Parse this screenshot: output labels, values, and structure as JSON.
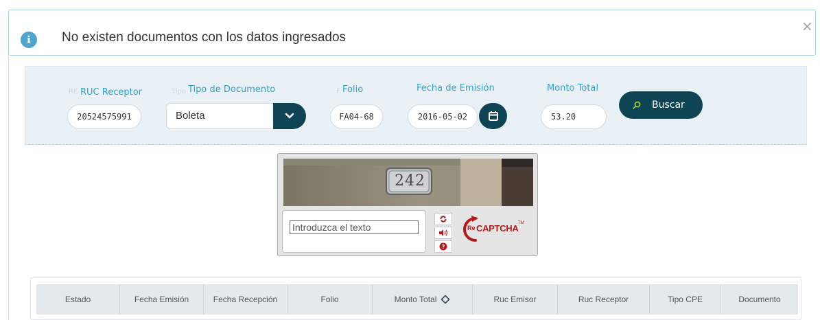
{
  "alert": {
    "message": "No existen documentos con los datos ingresados",
    "info_icon": "info-icon",
    "close_icon": "close-icon"
  },
  "search": {
    "ruc_receptor": {
      "label": "RUC Receptor",
      "ghost": "RE",
      "value": "20524575991"
    },
    "tipo_documento": {
      "label": "Tipo de Documento",
      "ghost": "Tipo",
      "value": "Boleta"
    },
    "folio": {
      "label": "Folio",
      "ghost": "F",
      "value": "FA04-68"
    },
    "fecha_emision": {
      "label": "Fecha de Emisión",
      "value": "2016-05-02"
    },
    "monto_total": {
      "label": "Monto Total",
      "value": "53.20"
    },
    "buscar_label": "Buscar"
  },
  "captcha": {
    "image_text": "242",
    "input_placeholder": "Introduzca el texto",
    "logo_text": "CAPTCHA",
    "logo_prefix": "Re",
    "tm": "TM"
  },
  "table": {
    "headers": [
      "Estado",
      "Fecha Emisión",
      "Fecha Recepción",
      "Folio",
      "Monto Total",
      "Ruc Emisor",
      "Ruc Receptor",
      "Tipo CPE",
      "Documento"
    ]
  },
  "colors": {
    "accent": "#2aa4d3",
    "dark_button": "#0f4455",
    "panel_bg": "#e9f1f6",
    "captcha_red": "#b31b1b"
  }
}
